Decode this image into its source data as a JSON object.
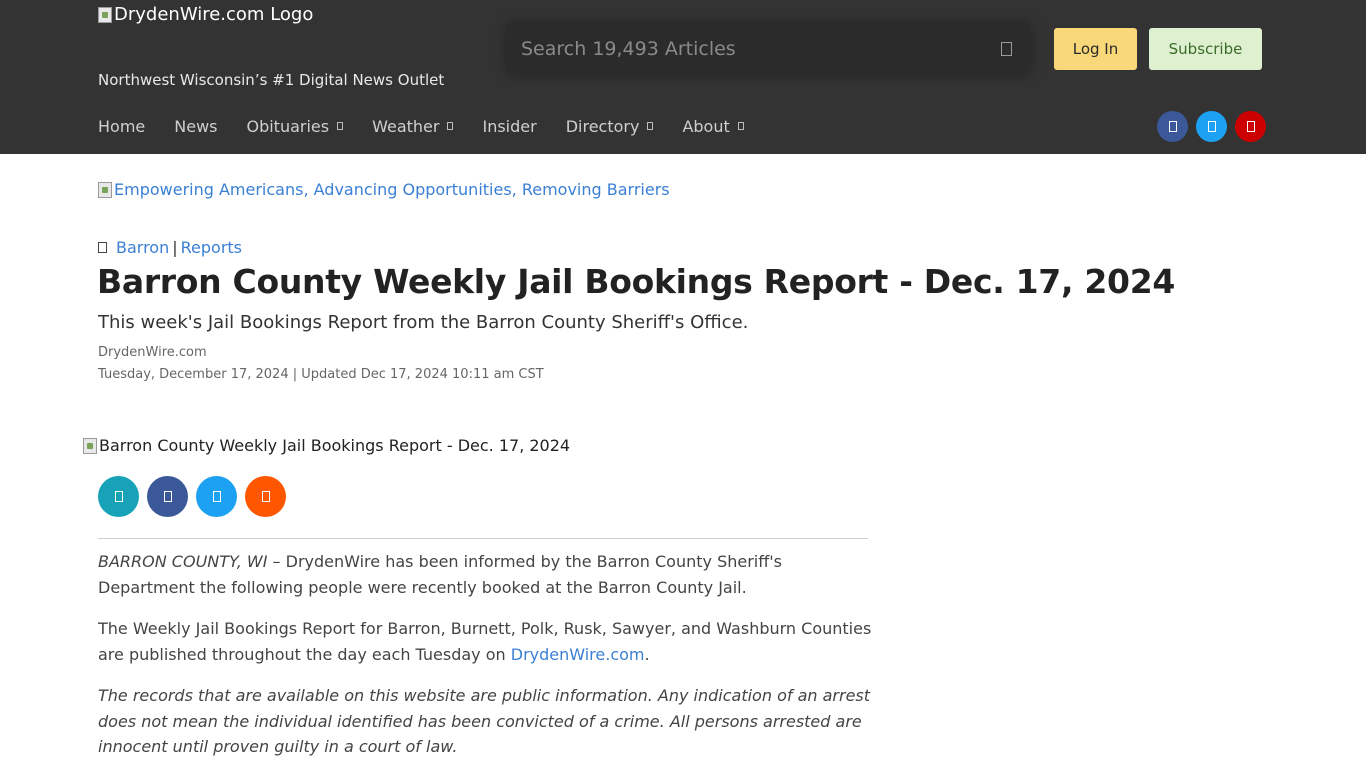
{
  "header": {
    "logo_alt": "DrydenWire.com Logo",
    "tagline": "Northwest Wisconsin’s #1 Digital News Outlet",
    "search_placeholder": "Search 19,493 Articles",
    "login_label": "Log In",
    "subscribe_label": "Subscribe",
    "background": "#333333"
  },
  "nav": {
    "items": [
      {
        "label": "Home",
        "has_dropdown": false
      },
      {
        "label": "News",
        "has_dropdown": false
      },
      {
        "label": "Obituaries",
        "has_dropdown": true
      },
      {
        "label": "Weather",
        "has_dropdown": true
      },
      {
        "label": "Insider",
        "has_dropdown": false
      },
      {
        "label": "Directory",
        "has_dropdown": true
      },
      {
        "label": "About",
        "has_dropdown": true
      }
    ]
  },
  "social": {
    "facebook_color": "#3b5998",
    "twitter_color": "#1da1f2",
    "youtube_color": "#cc0000"
  },
  "ad": {
    "alt": "Empowering Americans, Advancing Opportunities, Removing Barriers"
  },
  "article": {
    "categories": [
      "Barron",
      "Reports"
    ],
    "separator": "|",
    "title": "Barron County Weekly Jail Bookings Report - Dec. 17, 2024",
    "subtitle": "This week's Jail Bookings Report from the Barron County Sheriff's Office.",
    "source": "DrydenWire.com",
    "published": "Tuesday, December 17, 2024",
    "updated": "| Updated Dec 17, 2024 10:11 am CST",
    "hero_alt": "Barron County Weekly Jail Bookings Report - Dec. 17, 2024",
    "share_colors": [
      "#17a2b8",
      "#3b5998",
      "#1da1f2",
      "#ff5700"
    ],
    "p1_lead": "BARRON COUNTY, WI",
    "p1_rest": " – DrydenWire has been informed by the Barron County Sheriff's Department the following people were recently booked at the Barron County Jail.",
    "p2_text": "The Weekly Jail Bookings Report for Barron, Burnett, Polk, Rusk, Sawyer, and Washburn Counties are published throughout the day each Tuesday on ",
    "p2_link": "DrydenWire.com",
    "p2_end": ".",
    "p3_text": "The records that are available on this website are public information. Any indication of an arrest does not mean the individual identified has been convicted of a crime. All persons arrested are innocent until proven guilty in a court of law."
  }
}
